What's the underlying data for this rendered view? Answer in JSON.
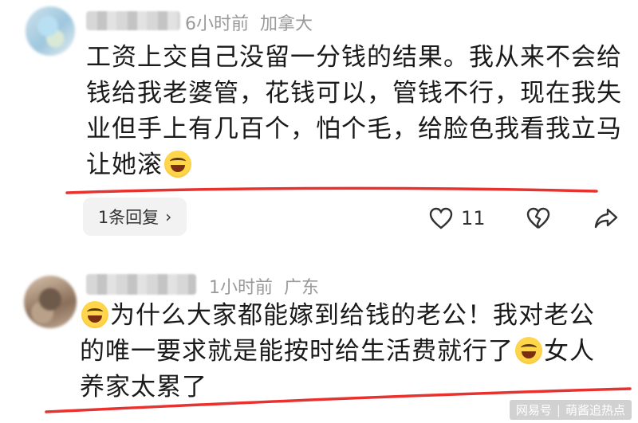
{
  "comments": [
    {
      "time": "6小时前",
      "location": "加拿大",
      "lines": [
        "工资上交自己没留一分钱的结果。我从来不会给",
        "钱给我老婆管，花钱可以，管钱不行，现在我失",
        "业但手上有几百个，怕个毛，给脸色我看我立马",
        "让她滚"
      ],
      "reply_label": "1条回复",
      "like_count": "11"
    },
    {
      "time": "1小时前",
      "location": "广东",
      "line1": "为什么大家都能嫁到给钱的老公！我对老公",
      "line2a": "的唯一要求就是能按时给生活费就行了",
      "line2b": "女人",
      "line3": "养家太累了"
    }
  ],
  "watermark": {
    "source": "网易号",
    "author": "萌酱追热点"
  },
  "colors": {
    "underline": "#e8322f",
    "meta": "#9a9a9a"
  }
}
